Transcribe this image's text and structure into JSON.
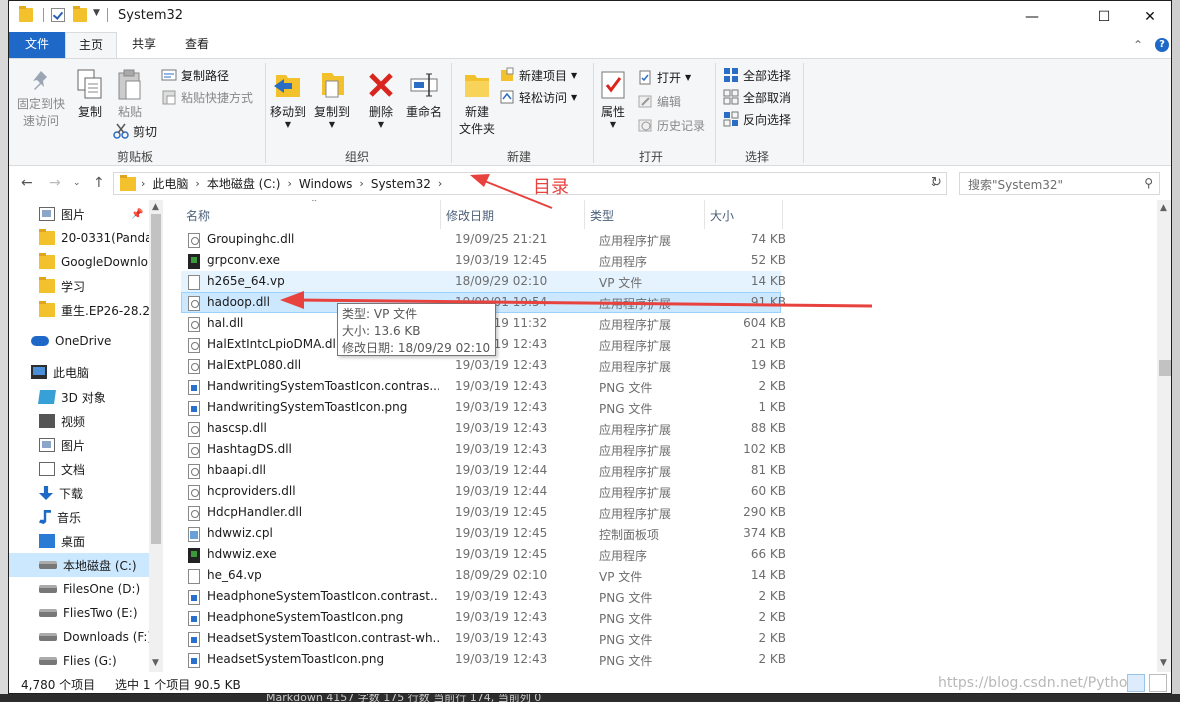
{
  "window": {
    "title": "System32",
    "minimize": "—",
    "maximize": "☐",
    "close": "✕"
  },
  "tabs": {
    "file": "文件",
    "home": "主页",
    "share": "共享",
    "view": "查看",
    "collapse": "⌃",
    "help": "?"
  },
  "ribbon": {
    "clipboard": {
      "pin": "固定到快\n速访问",
      "copy": "复制",
      "paste": "粘贴",
      "copy_path": "复制路径",
      "paste_shortcut": "粘贴快捷方式",
      "cut": "剪切",
      "label": "剪贴板"
    },
    "organize": {
      "move_to": "移动到",
      "copy_to": "复制到",
      "delete": "删除",
      "rename": "重命名",
      "label": "组织"
    },
    "new": {
      "new_folder": "新建\n文件夹",
      "new_item": "新建项目",
      "easy_access": "轻松访问",
      "label": "新建"
    },
    "open": {
      "properties": "属性",
      "open": "打开",
      "edit": "编辑",
      "history": "历史记录",
      "label": "打开"
    },
    "select": {
      "select_all": "全部选择",
      "select_none": "全部取消",
      "invert": "反向选择",
      "label": "选择"
    }
  },
  "address": {
    "crumbs": [
      "此电脑",
      "本地磁盘 (C:)",
      "Windows",
      "System32"
    ],
    "search_placeholder": "搜索\"System32\""
  },
  "nav": {
    "items": [
      {
        "label": "图片",
        "icon": "pictures-icon"
      },
      {
        "label": "20-0331(Panda",
        "icon": "folder-icon"
      },
      {
        "label": "GoogleDownlo",
        "icon": "folder-icon"
      },
      {
        "label": "学习",
        "icon": "folder-icon"
      },
      {
        "label": "重生.EP26-28.2(",
        "icon": "folder-icon"
      },
      {
        "label": "OneDrive",
        "icon": "onedrive-icon"
      },
      {
        "label": "此电脑",
        "icon": "this-pc-icon"
      },
      {
        "label": "3D 对象",
        "icon": "3d-objects-icon"
      },
      {
        "label": "视频",
        "icon": "videos-icon"
      },
      {
        "label": "图片",
        "icon": "pictures-icon"
      },
      {
        "label": "文档",
        "icon": "documents-icon"
      },
      {
        "label": "下载",
        "icon": "downloads-icon"
      },
      {
        "label": "音乐",
        "icon": "music-icon"
      },
      {
        "label": "桌面",
        "icon": "desktop-icon"
      },
      {
        "label": "本地磁盘 (C:)",
        "icon": "drive-icon"
      },
      {
        "label": "FilesOne (D:)",
        "icon": "drive-icon"
      },
      {
        "label": "FliesTwo (E:)",
        "icon": "drive-icon"
      },
      {
        "label": "Downloads (F:)",
        "icon": "drive-icon"
      },
      {
        "label": "Flies (G:)",
        "icon": "drive-icon"
      }
    ]
  },
  "columns": {
    "name": "名称",
    "date": "修改日期",
    "type": "类型",
    "size": "大小"
  },
  "files": [
    {
      "name": "Groupinghc.dll",
      "date": "19/09/25 21:21",
      "type": "应用程序扩展",
      "size": "74 KB",
      "icon": "dll"
    },
    {
      "name": "grpconv.exe",
      "date": "19/03/19 12:45",
      "type": "应用程序",
      "size": "52 KB",
      "icon": "exe"
    },
    {
      "name": "h265e_64.vp",
      "date": "18/09/29 02:10",
      "type": "VP 文件",
      "size": "14 KB",
      "icon": "vp"
    },
    {
      "name": "hadoop.dll",
      "date": "19/09/01 19:54",
      "type": "应用程序扩展",
      "size": "91 KB",
      "icon": "dll"
    },
    {
      "name": "hal.dll",
      "date": "20/02/19 11:32",
      "type": "应用程序扩展",
      "size": "604 KB",
      "icon": "dll"
    },
    {
      "name": "HalExtIntcLpioDMA.dll",
      "date": "19/03/19 12:43",
      "type": "应用程序扩展",
      "size": "21 KB",
      "icon": "dll"
    },
    {
      "name": "HalExtPL080.dll",
      "date": "19/03/19 12:43",
      "type": "应用程序扩展",
      "size": "19 KB",
      "icon": "dll"
    },
    {
      "name": "HandwritingSystemToastIcon.contras...",
      "date": "19/03/19 12:43",
      "type": "PNG 文件",
      "size": "2 KB",
      "icon": "png"
    },
    {
      "name": "HandwritingSystemToastIcon.png",
      "date": "19/03/19 12:43",
      "type": "PNG 文件",
      "size": "1 KB",
      "icon": "png"
    },
    {
      "name": "hascsp.dll",
      "date": "19/03/19 12:43",
      "type": "应用程序扩展",
      "size": "88 KB",
      "icon": "dll"
    },
    {
      "name": "HashtagDS.dll",
      "date": "19/03/19 12:43",
      "type": "应用程序扩展",
      "size": "102 KB",
      "icon": "dll"
    },
    {
      "name": "hbaapi.dll",
      "date": "19/03/19 12:44",
      "type": "应用程序扩展",
      "size": "81 KB",
      "icon": "dll"
    },
    {
      "name": "hcproviders.dll",
      "date": "19/03/19 12:44",
      "type": "应用程序扩展",
      "size": "60 KB",
      "icon": "dll"
    },
    {
      "name": "HdcpHandler.dll",
      "date": "19/03/19 12:45",
      "type": "应用程序扩展",
      "size": "290 KB",
      "icon": "dll"
    },
    {
      "name": "hdwwiz.cpl",
      "date": "19/03/19 12:45",
      "type": "控制面板项",
      "size": "374 KB",
      "icon": "cpl"
    },
    {
      "name": "hdwwiz.exe",
      "date": "19/03/19 12:45",
      "type": "应用程序",
      "size": "66 KB",
      "icon": "exe"
    },
    {
      "name": "he_64.vp",
      "date": "18/09/29 02:10",
      "type": "VP 文件",
      "size": "14 KB",
      "icon": "vp"
    },
    {
      "name": "HeadphoneSystemToastIcon.contrast...",
      "date": "19/03/19 12:43",
      "type": "PNG 文件",
      "size": "2 KB",
      "icon": "png"
    },
    {
      "name": "HeadphoneSystemToastIcon.png",
      "date": "19/03/19 12:43",
      "type": "PNG 文件",
      "size": "2 KB",
      "icon": "png"
    },
    {
      "name": "HeadsetSystemToastIcon.contrast-wh...",
      "date": "19/03/19 12:43",
      "type": "PNG 文件",
      "size": "2 KB",
      "icon": "png"
    },
    {
      "name": "HeadsetSystemToastIcon.png",
      "date": "19/03/19 12:43",
      "type": "PNG 文件",
      "size": "2 KB",
      "icon": "png"
    }
  ],
  "tooltip": {
    "type": "类型: VP 文件",
    "size": "大小: 13.6 KB",
    "date": "修改日期: 18/09/29 02:10"
  },
  "annotation": {
    "label": "目录",
    "color": "#e8423f"
  },
  "status": {
    "count": "4,780 个项目",
    "selected": "选中 1 个项目  90.5 KB"
  },
  "underlying": {
    "text": "Markdown  4157 字数  175 行数  当前行 174, 当前列 0"
  },
  "watermark": "https://blog.csdn.net/Pytho",
  "colors": {
    "accent": "#1e69c8",
    "selected_bg": "#cce8ff",
    "hover_bg": "#e5f3ff"
  }
}
